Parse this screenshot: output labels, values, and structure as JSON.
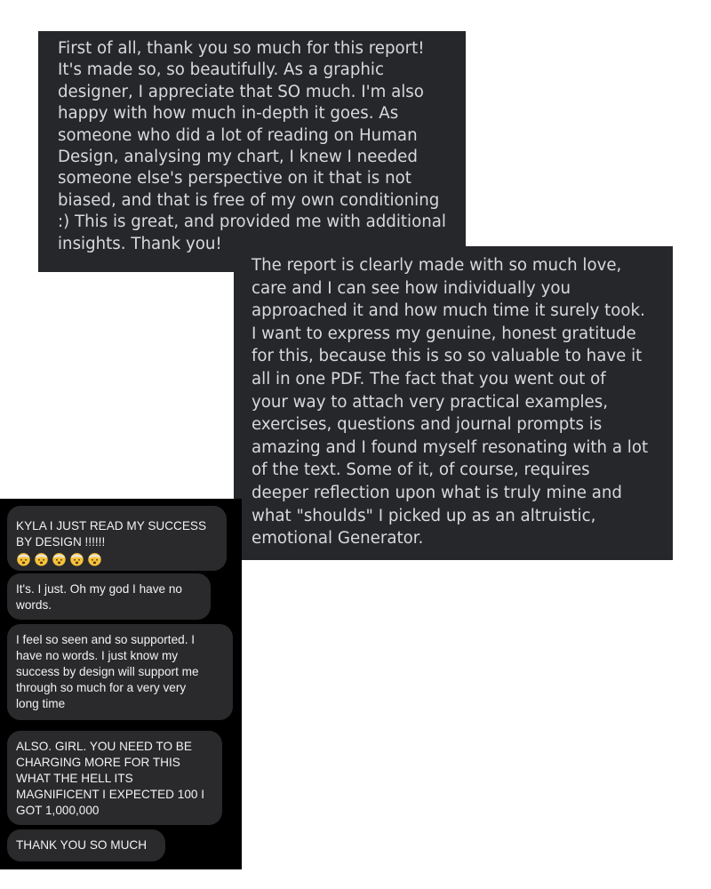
{
  "cards": [
    {
      "text": "First of all, thank you so much for this report!\nIt's made so, so beautifully. As a graphic\ndesigner, I appreciate that SO much. I'm also\nhappy with how much in-depth it goes. As\nsomeone who did a lot of reading on Human\nDesign, analysing my chart, I knew I needed\nsomeone else's perspective on it that is not\nbiased, and that is free of my own conditioning\n:) This is great, and provided me with additional\ninsights. Thank you!"
    },
    {
      "text": "The report is clearly made with so much love,\ncare and I can see how individually you\napproached it and how much time it surely took.\nI want to express my genuine, honest gratitude\nfor this, because this is so so valuable to have it\nall in one PDF. The fact that you went out of\nyour way to attach very practical examples,\nexercises, questions and journal prompts is\namazing and I found myself resonating with a lot\nof the text. Some of it, of course, requires\ndeeper reflection upon what is truly mine and\nwhat \"shoulds\" I picked up as an altruistic,\nemotional Generator."
    }
  ],
  "chat": {
    "messages": [
      {
        "text": "KYLA I JUST READ MY SUCCESS\nBY DESIGN !!!!!!",
        "emojis": [
          "exploding-head",
          "exploding-head",
          "exploding-head",
          "exploding-head",
          "exploding-head"
        ]
      },
      {
        "text": "It's. I just. Oh my god I have no\nwords."
      },
      {
        "text": "I feel so seen and so supported. I\nhave no words. I just know my\nsuccess by design will support me\nthrough so much for a very very\nlong time"
      },
      {
        "text": "ALSO. GIRL. YOU NEED TO BE\nCHARGING MORE FOR THIS\nWHAT THE HELL ITS\nMAGNIFICENT I EXPECTED 100 I\nGOT 1,000,000"
      },
      {
        "text": "THANK YOU SO MUCH"
      }
    ]
  },
  "colors": {
    "card_bg": "#25272b",
    "card_text": "#d9d9dc",
    "chat_bg": "#000000",
    "bubble_bg": "#2a2a2c",
    "bubble_text": "#f2f2f2"
  }
}
